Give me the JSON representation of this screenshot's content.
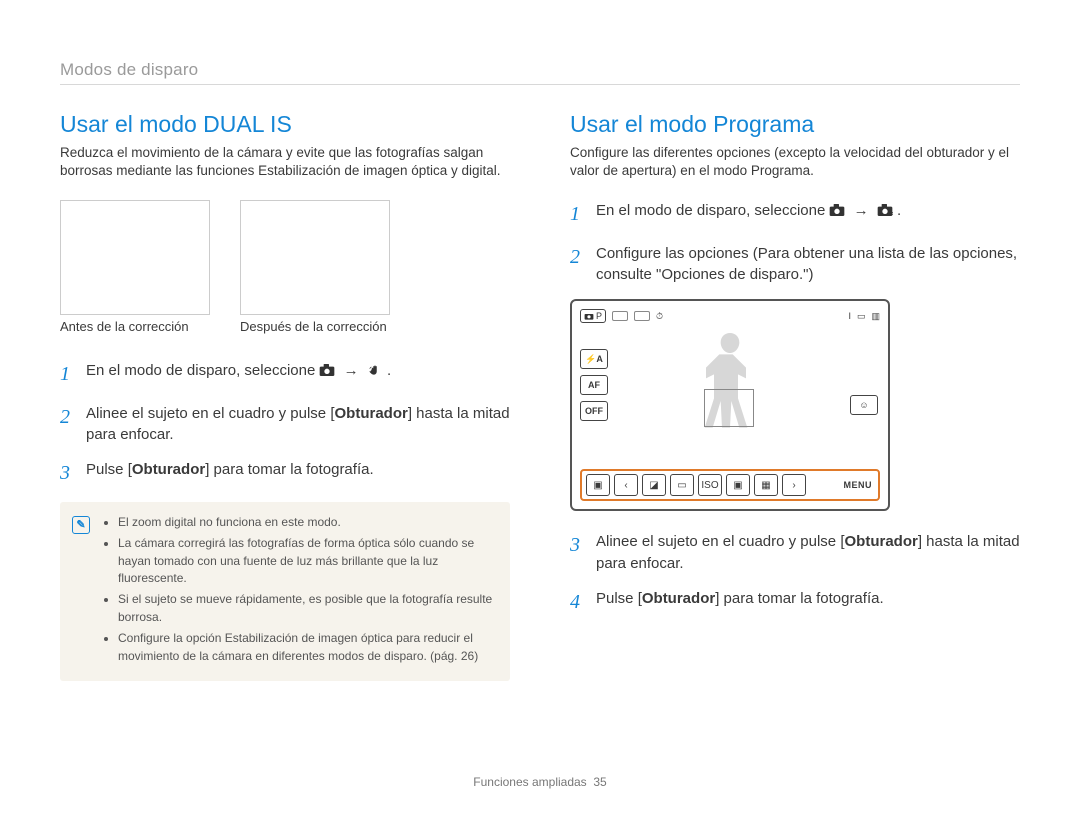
{
  "header": {
    "breadcrumb": "Modos de disparo"
  },
  "left": {
    "title": "Usar el modo DUAL IS",
    "intro": "Reduzca el movimiento de la cámara y evite que las fotografías salgan borrosas mediante las funciones Estabilización de imagen óptica y digital.",
    "caption_before": "Antes de la corrección",
    "caption_after": "Después de la corrección",
    "step1_a": "En el modo de disparo, seleccione ",
    "step1_arrow": "→",
    "step1_end": ".",
    "step2_a": "Alinee el sujeto en el cuadro y pulse [",
    "step2_b": "Obturador",
    "step2_c": "] hasta la mitad para enfocar.",
    "step3_a": "Pulse [",
    "step3_b": "Obturador",
    "step3_c": "] para tomar la fotografía.",
    "notes": [
      "El zoom digital no funciona en este modo.",
      "La cámara corregirá las fotografías de forma óptica sólo cuando se hayan tomado con una fuente de luz más brillante que la luz fluorescente.",
      "Si el sujeto se mueve rápidamente, es posible que la fotografía resulte borrosa.",
      "Configure la opción Estabilización de imagen óptica para reducir el movimiento de la cámara en diferentes modos de disparo. (pág. 26)"
    ]
  },
  "right": {
    "title": "Usar el modo Programa",
    "intro": "Configure las diferentes opciones (excepto la velocidad del obturador y el valor de apertura) en el modo Programa.",
    "step1_a": "En el modo de disparo, seleccione ",
    "step1_arrow": "→",
    "step1_end": ".",
    "step2": "Configure las opciones (Para obtener una lista de las opciones, consulte \"Opciones de disparo.\")",
    "lcd": {
      "mode_badge": "P",
      "left_buttons": [
        "⚡A",
        "AF",
        "OFF"
      ],
      "top_right": "I",
      "menu": "MENU",
      "iso": "ISO"
    },
    "step3_a": "Alinee el sujeto en el cuadro y pulse [",
    "step3_b": "Obturador",
    "step3_c": "] hasta la mitad para enfocar.",
    "step4_a": "Pulse [",
    "step4_b": "Obturador",
    "step4_c": "] para tomar la fotografía."
  },
  "footer": {
    "section": "Funciones ampliadas",
    "page": "35"
  }
}
